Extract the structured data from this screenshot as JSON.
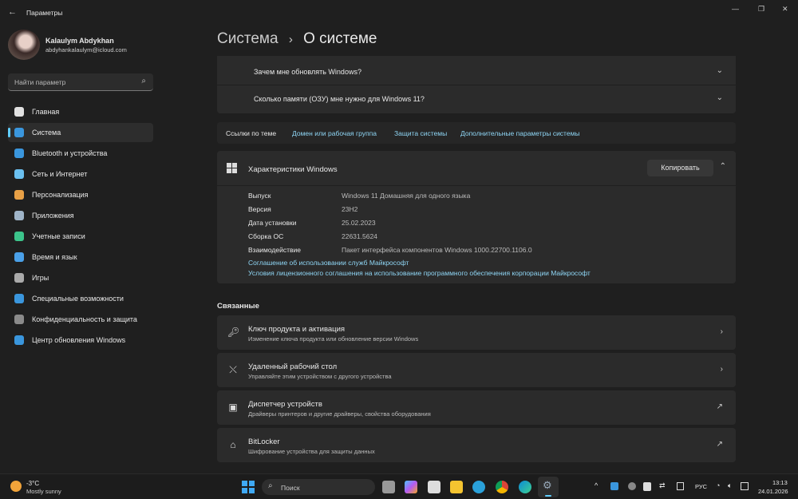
{
  "window": {
    "title": "Параметры",
    "back": "←",
    "minimize": "—",
    "maximize": "❐",
    "close": "✕"
  },
  "user": {
    "name": "Kalaulym Abdykhan",
    "email": "abdyhankalaulym@icloud.com"
  },
  "search": {
    "placeholder": "Найти параметр"
  },
  "nav": [
    {
      "label": "Главная",
      "color": "#e0e0e0"
    },
    {
      "label": "Система",
      "color": "#3a96dd"
    },
    {
      "label": "Bluetooth и устройства",
      "color": "#3a96dd"
    },
    {
      "label": "Сеть и Интернет",
      "color": "#6bc0f0"
    },
    {
      "label": "Персонализация",
      "color": "#e8a046"
    },
    {
      "label": "Приложения",
      "color": "#9fb4c8"
    },
    {
      "label": "Учетные записи",
      "color": "#3cc48b"
    },
    {
      "label": "Время и язык",
      "color": "#4aa0e8"
    },
    {
      "label": "Игры",
      "color": "#aaaaaa"
    },
    {
      "label": "Специальные возможности",
      "color": "#3a96dd"
    },
    {
      "label": "Конфиденциальность и защита",
      "color": "#8a8a8a"
    },
    {
      "label": "Центр обновления Windows",
      "color": "#3a96dd"
    }
  ],
  "breadcrumb": {
    "parent": "Система",
    "sep": "›",
    "current": "О системе"
  },
  "faq": [
    "Зачем мне обновлять Windows?",
    "Сколько памяти (ОЗУ) мне нужно для Windows 11?"
  ],
  "links": {
    "label": "Ссылки по теме",
    "items": [
      "Домен или рабочая группа",
      "Защита системы",
      "Дополнительные параметры системы"
    ]
  },
  "specs": {
    "title": "Характеристики Windows",
    "copy": "Копировать",
    "rows": [
      {
        "k": "Выпуск",
        "v": "Windows 11 Домашняя для одного языка"
      },
      {
        "k": "Версия",
        "v": "23H2"
      },
      {
        "k": "Дата установки",
        "v": "25.02.2023"
      },
      {
        "k": "Сборка ОС",
        "v": "22631.5624"
      },
      {
        "k": "Взаимодействие",
        "v": "Пакет интерфейса компонентов Windows 1000.22700.1106.0"
      }
    ],
    "link1": "Соглашение об использовании служб Майкрософт",
    "link2": "Условия лицензионного соглашения на использование программного обеспечения корпорации Майкрософт"
  },
  "related": {
    "title": "Связанные",
    "items": [
      {
        "t": "Ключ продукта и активация",
        "s": "Изменение ключа продукта или обновление версии Windows"
      },
      {
        "t": "Удаленный рабочий стол",
        "s": "Управляйте этим устройством с другого устройства"
      },
      {
        "t": "Диспетчер устройств",
        "s": "Драйверы принтеров и другие драйверы, свойства оборудования"
      },
      {
        "t": "BitLocker",
        "s": "Шифрование устройства для защиты данных"
      }
    ]
  },
  "taskbar": {
    "temp": "-3°C",
    "weather": "Mostly sunny",
    "search": "Поиск",
    "lang": "РУС",
    "time": "13:13",
    "date": "24.01.2026"
  }
}
